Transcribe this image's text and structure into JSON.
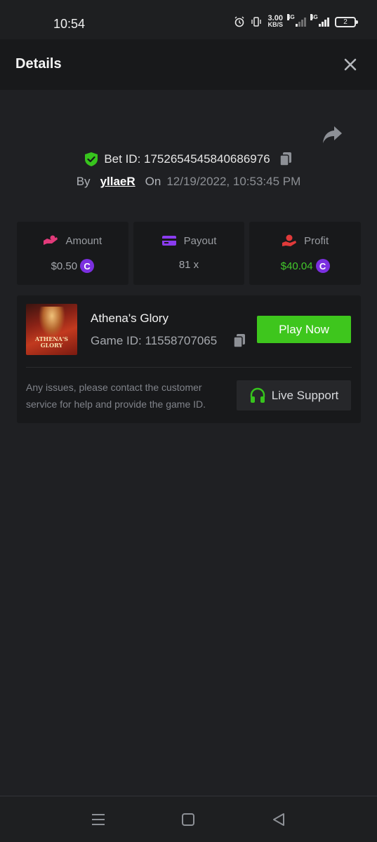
{
  "status_bar": {
    "time": "10:54",
    "net_speed_value": "3.00",
    "net_speed_unit": "KB/S",
    "network_1": "4G",
    "network_2": "4G",
    "battery": "2"
  },
  "header": {
    "title": "Details"
  },
  "bet": {
    "id_label": "Bet ID: 1752654545840686976",
    "by_label": "By",
    "username": "yllaeR",
    "on_label": "On",
    "datetime": "12/19/2022, 10:53:45 PM"
  },
  "stats": [
    {
      "label": "Amount",
      "value": "$0.50",
      "icon": "amount-hand-icon",
      "has_coin": true
    },
    {
      "label": "Payout",
      "value": "81 x",
      "icon": "card-icon",
      "has_coin": false
    },
    {
      "label": "Profit",
      "value": "$40.04",
      "icon": "profit-hand-icon",
      "has_coin": true
    }
  ],
  "coin_symbol": "C",
  "game": {
    "thumbnail_text": "ATHENA'S GLORY",
    "name": "Athena's Glory",
    "id_label": "Game ID: 11558707065",
    "play_label": "Play Now",
    "help_text": "Any issues, please contact the customer service for help and provide the game ID.",
    "support_label": "Live Support"
  },
  "colors": {
    "background": "#1f2023",
    "card": "#18191b",
    "accent_green": "#3ec61d",
    "profit_green": "#43c82c",
    "coin_purple": "#7b2fe0",
    "amount_pink": "#e23a7a",
    "payout_purple": "#8a3cf0",
    "profit_red": "#e03a3a"
  }
}
